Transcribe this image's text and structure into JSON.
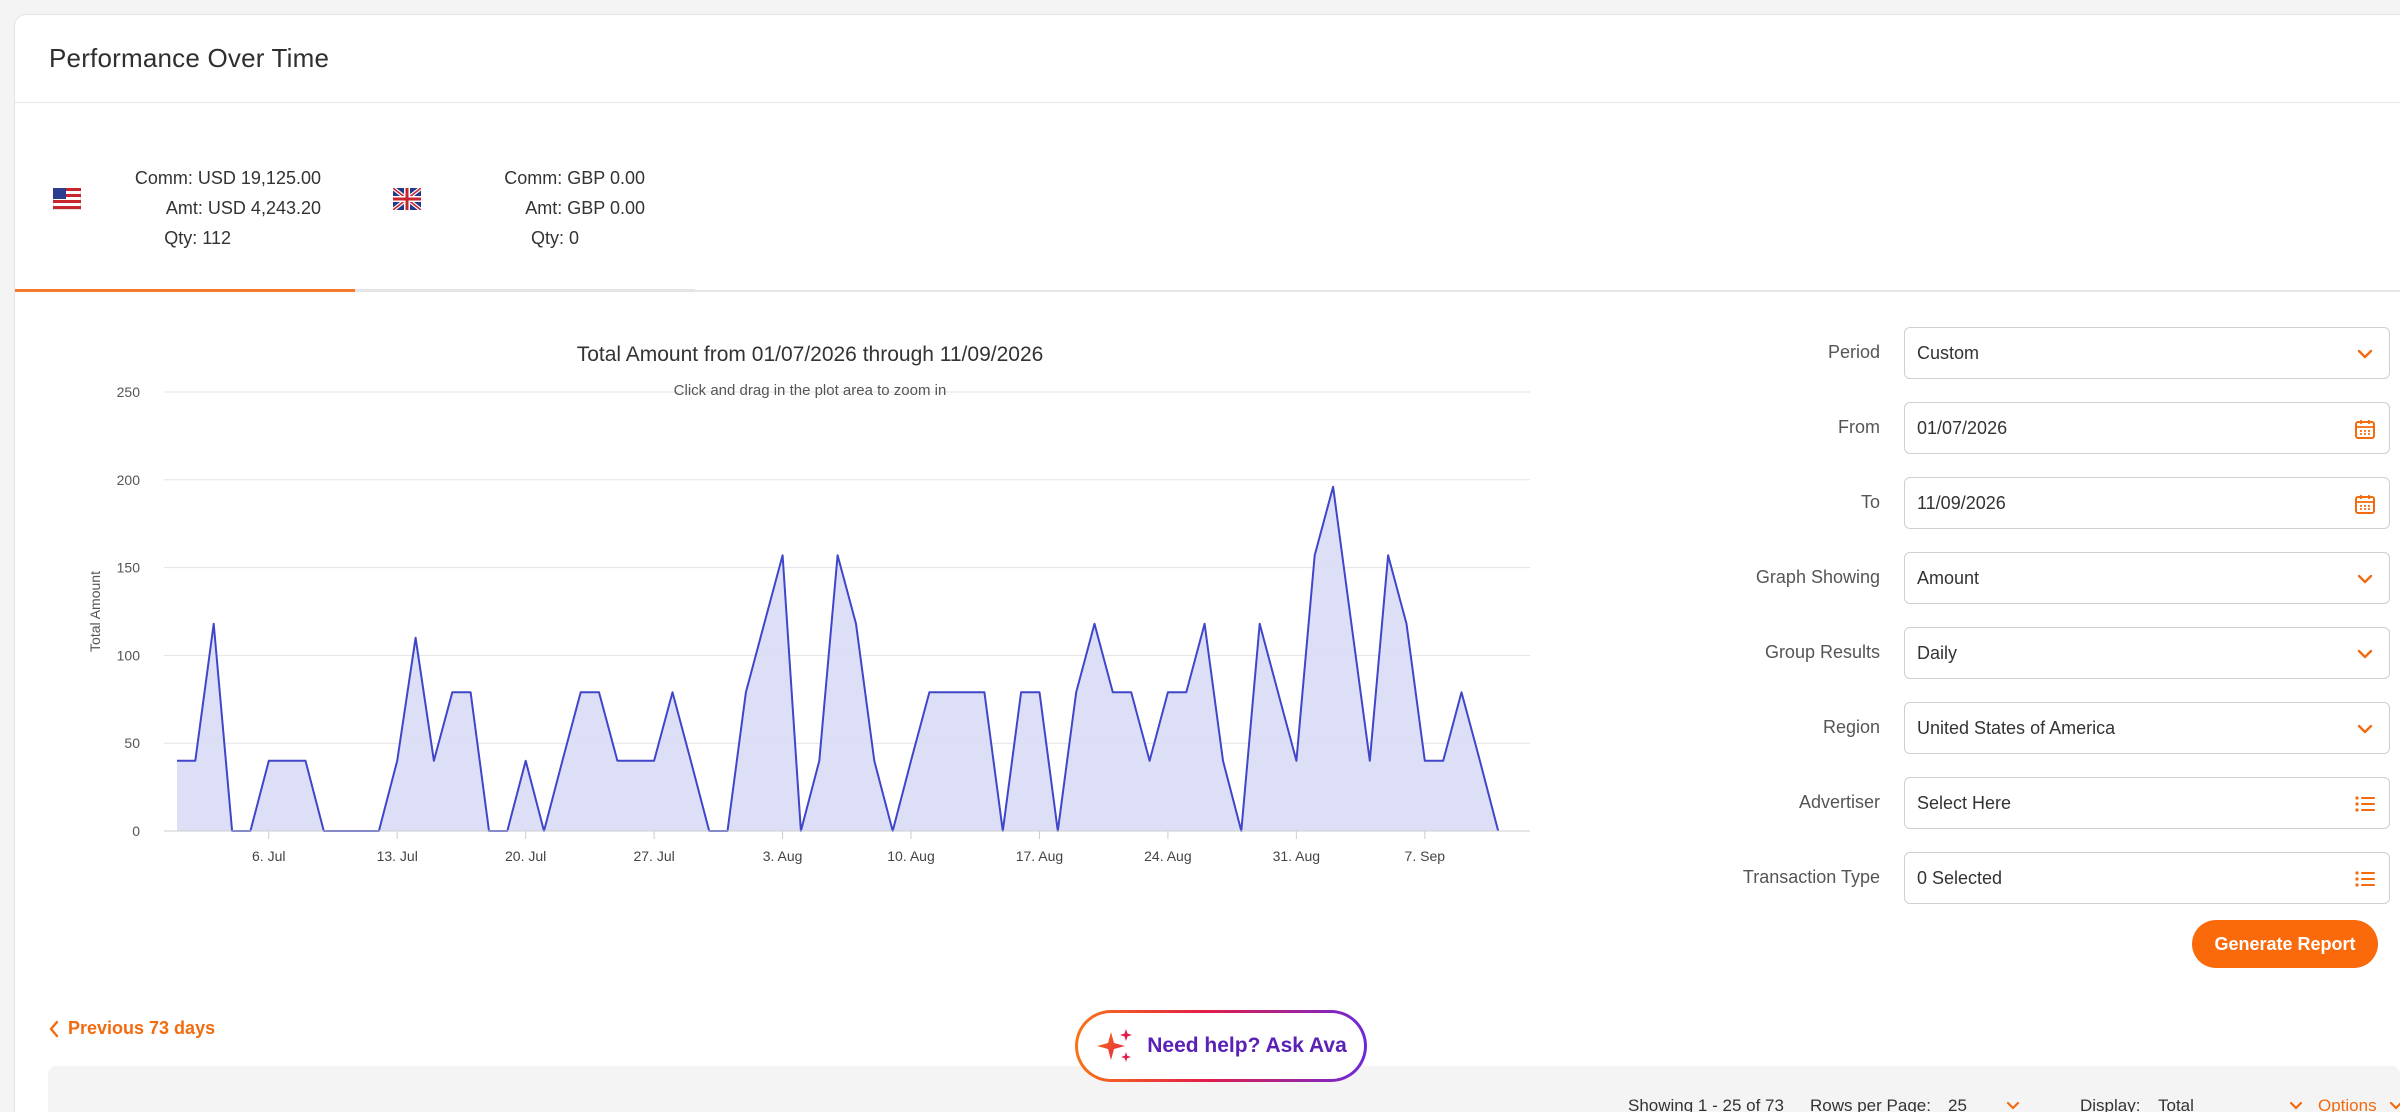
{
  "page_title": "Performance Over Time",
  "tabs": [
    {
      "flag": "us-flag-icon",
      "comm": "Comm: USD 19,125.00",
      "amt": "Amt: USD 4,243.20",
      "qty": "Qty: 112",
      "active": true
    },
    {
      "flag": "uk-flag-icon",
      "comm": "Comm: GBP 0.00",
      "amt": "Amt: GBP 0.00",
      "qty": "Qty: 0",
      "active": false
    }
  ],
  "chart_data": {
    "type": "area",
    "title": "Total Amount from 01/07/2026 through 11/09/2026",
    "subtitle": "Click and drag in the plot area to zoom in",
    "xlabel": "",
    "ylabel": "Total Amount",
    "ylim": [
      0,
      250
    ],
    "yticks": [
      "0",
      "50",
      "100",
      "150",
      "200",
      "250"
    ],
    "xticks": [
      {
        "label": "6. Jul",
        "day": 6
      },
      {
        "label": "13. Jul",
        "day": 13
      },
      {
        "label": "20. Jul",
        "day": 20
      },
      {
        "label": "27. Jul",
        "day": 27
      },
      {
        "label": "3. Aug",
        "day": 34
      },
      {
        "label": "10. Aug",
        "day": 41
      },
      {
        "label": "17. Aug",
        "day": 48
      },
      {
        "label": "24. Aug",
        "day": 55
      },
      {
        "label": "31. Aug",
        "day": 62
      },
      {
        "label": "7. Sep",
        "day": 69
      }
    ],
    "x_start_day": 1,
    "values": [
      40,
      40,
      118,
      0,
      0,
      40,
      40,
      40,
      0,
      0,
      0,
      0,
      40,
      110,
      40,
      79,
      79,
      0,
      0,
      40,
      0,
      40,
      79,
      79,
      40,
      40,
      40,
      79,
      40,
      0,
      0,
      79,
      118,
      157,
      0,
      40,
      157,
      118,
      40,
      0,
      40,
      79,
      79,
      79,
      79,
      0,
      79,
      79,
      0,
      79,
      118,
      79,
      79,
      40,
      79,
      79,
      118,
      40,
      0,
      118,
      79,
      40,
      157,
      196,
      118,
      40,
      157,
      118,
      40,
      40,
      79,
      40,
      0
    ],
    "grid": true,
    "legend": "none",
    "line_color": "#3f46c9",
    "fill_color": "#d9dcf5"
  },
  "form": {
    "period": {
      "label": "Period",
      "value": "Custom",
      "icon": "chevron-down-icon"
    },
    "from": {
      "label": "From",
      "value": "01/07/2026",
      "icon": "calendar-icon"
    },
    "to": {
      "label": "To",
      "value": "11/09/2026",
      "icon": "calendar-icon"
    },
    "graph_showing": {
      "label": "Graph Showing",
      "value": "Amount",
      "icon": "chevron-down-icon"
    },
    "group_results": {
      "label": "Group Results",
      "value": "Daily",
      "icon": "chevron-down-icon"
    },
    "region": {
      "label": "Region",
      "value": "United States of America",
      "icon": "chevron-down-icon"
    },
    "advertiser": {
      "label": "Advertiser",
      "value": "Select Here",
      "icon": "list-icon"
    },
    "transaction_type": {
      "label": "Transaction Type",
      "value": "0 Selected",
      "icon": "list-icon"
    }
  },
  "generate_label": "Generate Report",
  "previous_link": "Previous 73 days",
  "ava_label": "Need help? Ask Ava",
  "bottom_bar": {
    "showing": "Showing 1 - 25 of 73",
    "rows_label": "Rows per Page:",
    "rows_value": "25",
    "display_label": "Display:",
    "display_value": "Total",
    "options_label": "Options"
  },
  "colors": {
    "accent": "#fa6a0a",
    "chart_line": "#3f46c9",
    "ava_text": "#5b21b6"
  }
}
